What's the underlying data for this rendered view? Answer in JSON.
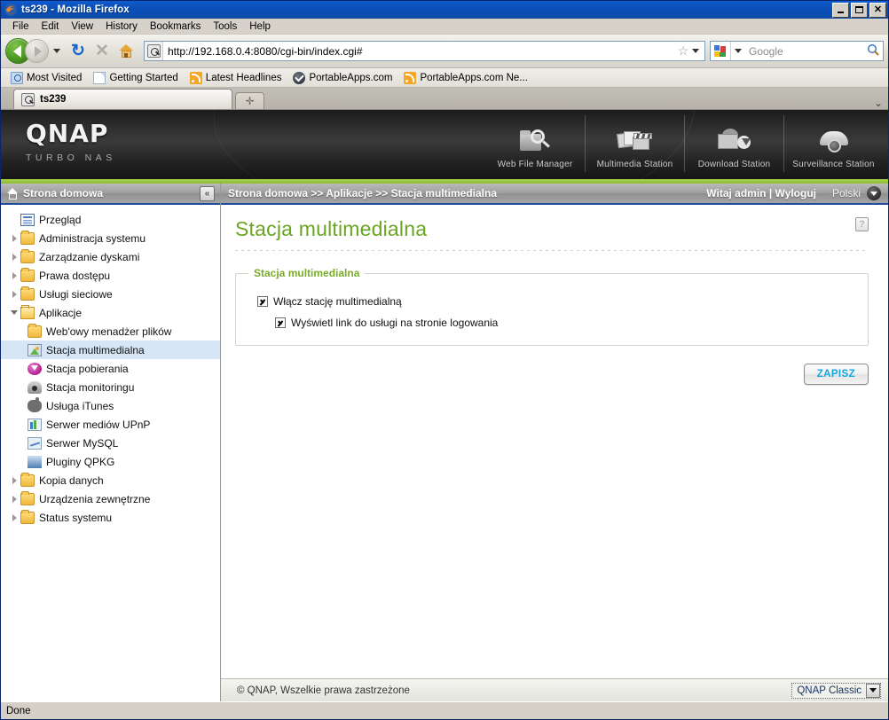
{
  "window": {
    "title": "ts239 - Mozilla Firefox",
    "icon": "firefox-icon",
    "controls": {
      "minimize": "minimize-button",
      "maximize": "maximize-button",
      "close": "close-button"
    }
  },
  "menubar": {
    "items": [
      "File",
      "Edit",
      "View",
      "History",
      "Bookmarks",
      "Tools",
      "Help"
    ]
  },
  "toolbar": {
    "back": "back-button",
    "forward": "forward-button",
    "reload": "reload-button",
    "stop": "stop-button",
    "home": "home-button",
    "url": "http://192.168.0.4:8080/cgi-bin/index.cgi#",
    "search_placeholder": "Google",
    "search_value": ""
  },
  "bookmarks": [
    {
      "label": "Most Visited",
      "icon": "most-visited-icon"
    },
    {
      "label": "Getting Started",
      "icon": "page-icon"
    },
    {
      "label": "Latest Headlines",
      "icon": "rss-icon"
    },
    {
      "label": "PortableApps.com",
      "icon": "portableapps-icon"
    },
    {
      "label": "PortableApps.com Ne...",
      "icon": "rss-icon"
    }
  ],
  "tabs": {
    "active": "ts239",
    "new_tab": "+",
    "list_all": "⌄"
  },
  "banner": {
    "logo": "QNAP",
    "tagline": "TURBO NAS",
    "nav": [
      {
        "label": "Web File Manager",
        "icon": "web-file-manager-icon"
      },
      {
        "label": "Multimedia Station",
        "icon": "multimedia-station-icon"
      },
      {
        "label": "Download Station",
        "icon": "download-station-icon"
      },
      {
        "label": "Surveillance Station",
        "icon": "surveillance-station-icon"
      }
    ]
  },
  "sidebar": {
    "header": "Strona domowa",
    "header_icon": "home-icon",
    "collapse_icon": "«",
    "items": [
      {
        "label": "Przegląd",
        "icon": "overview-icon",
        "level": 1,
        "twisty": "none",
        "selected": false
      },
      {
        "label": "Administracja systemu",
        "icon": "folder-icon",
        "level": 1,
        "twisty": "closed",
        "selected": false
      },
      {
        "label": "Zarządzanie dyskami",
        "icon": "folder-icon",
        "level": 1,
        "twisty": "closed",
        "selected": false
      },
      {
        "label": "Prawa dostępu",
        "icon": "folder-icon",
        "level": 1,
        "twisty": "closed",
        "selected": false
      },
      {
        "label": "Usługi sieciowe",
        "icon": "folder-icon",
        "level": 1,
        "twisty": "closed",
        "selected": false
      },
      {
        "label": "Aplikacje",
        "icon": "folder-open-icon",
        "level": 1,
        "twisty": "open",
        "selected": false
      },
      {
        "label": "Web'owy menadżer plików",
        "icon": "folder-icon",
        "level": 2,
        "twisty": "none",
        "selected": false
      },
      {
        "label": "Stacja multimedialna",
        "icon": "multimedia-icon",
        "level": 2,
        "twisty": "none",
        "selected": true
      },
      {
        "label": "Stacja pobierania",
        "icon": "download-icon",
        "level": 2,
        "twisty": "none",
        "selected": false
      },
      {
        "label": "Stacja monitoringu",
        "icon": "camera-icon",
        "level": 2,
        "twisty": "none",
        "selected": false
      },
      {
        "label": "Usługa iTunes",
        "icon": "apple-icon",
        "level": 2,
        "twisty": "none",
        "selected": false
      },
      {
        "label": "Serwer mediów UPnP",
        "icon": "upnp-icon",
        "level": 2,
        "twisty": "none",
        "selected": false
      },
      {
        "label": "Serwer MySQL",
        "icon": "mysql-icon",
        "level": 2,
        "twisty": "none",
        "selected": false
      },
      {
        "label": "Pluginy QPKG",
        "icon": "qpkg-icon",
        "level": 2,
        "twisty": "none",
        "selected": false
      },
      {
        "label": "Kopia danych",
        "icon": "folder-icon",
        "level": 1,
        "twisty": "closed",
        "selected": false
      },
      {
        "label": "Urządzenia zewnętrzne",
        "icon": "folder-icon",
        "level": 1,
        "twisty": "closed",
        "selected": false
      },
      {
        "label": "Status systemu",
        "icon": "folder-icon",
        "level": 1,
        "twisty": "closed",
        "selected": false
      }
    ]
  },
  "topbar": {
    "breadcrumb": "Strona domowa >> Aplikacje >> Stacja multimedialna",
    "welcome": "Witaj admin | Wyloguj",
    "language": "Polski"
  },
  "main": {
    "title": "Stacja multimedialna",
    "help": "?",
    "fieldset_legend": "Stacja multimedialna",
    "checkboxes": [
      {
        "label": "Włącz stację multimedialną",
        "checked": true,
        "indent": false
      },
      {
        "label": "Wyświetl link do usługi na stronie logowania",
        "checked": true,
        "indent": true
      }
    ],
    "save_label": "ZAPISZ"
  },
  "pagefooter": {
    "copyright": "© QNAP, Wszelkie prawa zastrzeżone",
    "theme": "QNAP Classic"
  },
  "statusbar": {
    "text": "Done"
  },
  "colors": {
    "accent_green": "#6aa521",
    "legend_green": "#79ad28",
    "save_text": "#12a6e0",
    "selection_blue": "#d6e6f7",
    "titlebar_blue": "#0a50b8"
  }
}
